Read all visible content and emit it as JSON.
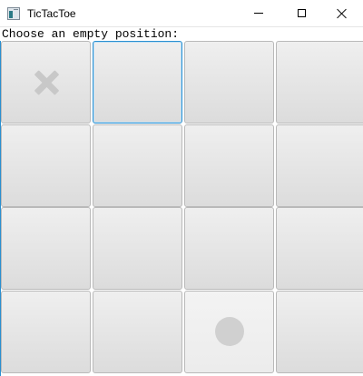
{
  "window": {
    "title": "TicTacToe",
    "icon": "app-window-icon",
    "controls": [
      "minimize-icon",
      "maximize-icon",
      "close-icon"
    ]
  },
  "prompt": "Choose an empty position:",
  "board": {
    "rows": 4,
    "cols": 4,
    "cells": [
      [
        "X",
        "",
        "",
        ""
      ],
      [
        "",
        "",
        "",
        ""
      ],
      [
        "",
        "",
        "",
        ""
      ],
      [
        "",
        "",
        "O",
        ""
      ]
    ],
    "focused_cell": [
      0,
      1
    ],
    "mark_color": "#c8c8c8",
    "focus_color": "#2a8fd0"
  }
}
